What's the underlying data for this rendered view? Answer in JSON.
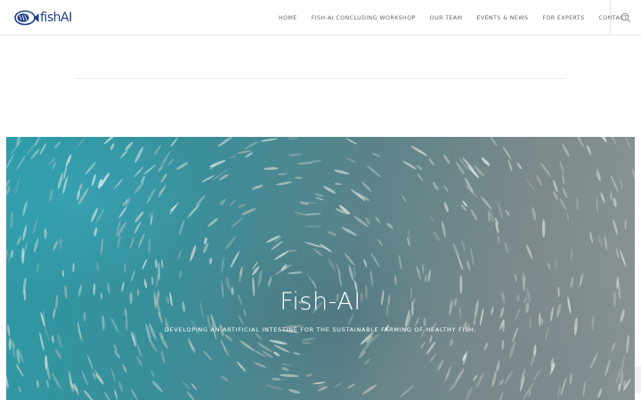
{
  "header": {
    "logo_text": "fishAI",
    "logo_icon": "fish-logo-icon",
    "nav": [
      {
        "label": "HOME"
      },
      {
        "label": "FISH-AI CONCLUDING WORKSHOP"
      },
      {
        "label": "OUR TEAM"
      },
      {
        "label": "EVENTS & NEWS"
      },
      {
        "label": "FOR EXPERTS"
      },
      {
        "label": "CONTACT"
      }
    ],
    "search_icon": "search-icon"
  },
  "hero": {
    "title": "Fish-AI",
    "subtitle": "DEVELOPING AN ARTIFICIAL INTESTINE FOR THE SUSTAINABLE FARMING OF HEALTHY FISH."
  },
  "colors": {
    "brand": "#1f3f8a",
    "nav_text": "#666666",
    "divider": "#e6e6e6",
    "water": "#2c9aa6"
  }
}
